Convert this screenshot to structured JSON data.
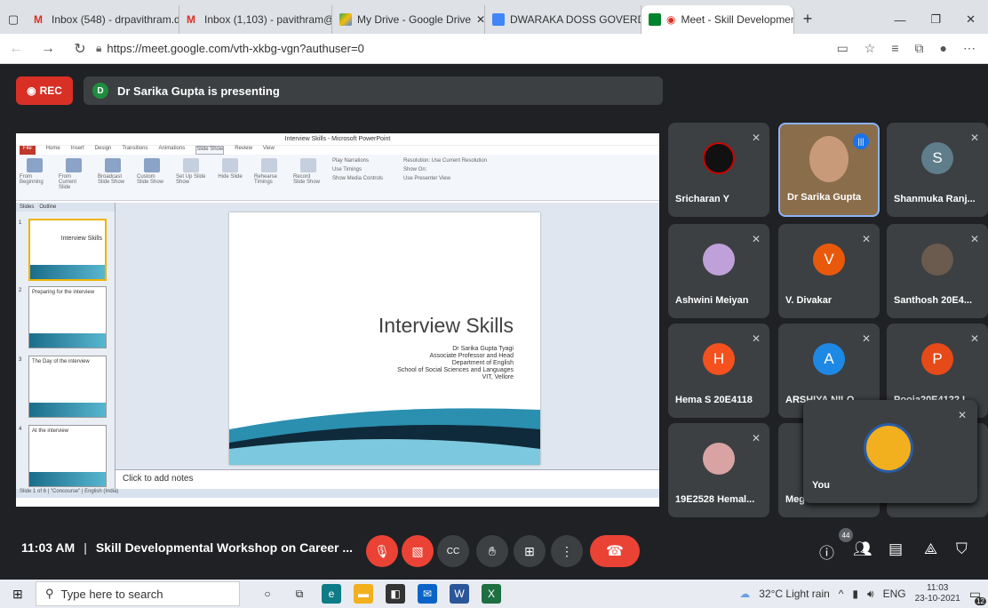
{
  "browser": {
    "tabs": [
      {
        "label": "Inbox (548) - drpavithram.dg",
        "icon": "gmail-icon"
      },
      {
        "label": "Inbox (1,103) - pavithram@dc",
        "icon": "gmail-icon"
      },
      {
        "label": "My Drive - Google Drive",
        "icon": "drive-icon"
      },
      {
        "label": "DWARAKA DOSS GOVERDHA",
        "icon": "calendar-icon"
      },
      {
        "label": "Meet - Skill Developmen",
        "icon": "meet-icon"
      }
    ],
    "url": "https://meet.google.com/vth-xkbg-vgn?authuser=0"
  },
  "meet": {
    "rec_label": "REC",
    "presenter_initial": "D",
    "presenting_text": "Dr Sarika Gupta is presenting",
    "participants": [
      {
        "name": "Sricharan Y",
        "initial": "",
        "color": "#111111"
      },
      {
        "name": "Dr Sarika Gupta",
        "initial": "",
        "color": "#8a6d4a"
      },
      {
        "name": "Shanmuka Ranj...",
        "initial": "S",
        "color": "#607d8b"
      },
      {
        "name": "Ashwini Meiyan",
        "initial": "",
        "color": "#c0a0d8"
      },
      {
        "name": "V. Divakar",
        "initial": "V",
        "color": "#e8590c"
      },
      {
        "name": "Santhosh 20E4...",
        "initial": "",
        "color": "#6b5a4e"
      },
      {
        "name": "Hema S 20E4118",
        "initial": "H",
        "color": "#f4511e"
      },
      {
        "name": "ARSHIYA NILO...",
        "initial": "A",
        "color": "#1e88e5"
      },
      {
        "name": "Pooja20E4122 I...",
        "initial": "P",
        "color": "#e64a19"
      },
      {
        "name": "19E2528 Hemal...",
        "initial": "",
        "color": "#d9a3a3"
      },
      {
        "name": "Meg",
        "initial": "",
        "color": "#3c4043"
      }
    ],
    "self_label": "You",
    "meeting_time": "11:03 AM",
    "meeting_title": "Skill Developmental Workshop on Career ...",
    "participant_count": "44"
  },
  "powerpoint": {
    "window_title": "Interview Skills - Microsoft PowerPoint",
    "menu_tabs": [
      "File",
      "Home",
      "Insert",
      "Design",
      "Transitions",
      "Animations",
      "Slide Show",
      "Review",
      "View"
    ],
    "ribbon": [
      "From Beginning",
      "From Current Slide",
      "Broadcast Slide Show",
      "Custom Slide Show",
      "Set Up Slide Show",
      "Hide Slide",
      "Rehearse Timings",
      "Record Slide Show",
      "Play Narrations",
      "Use Timings",
      "Show Media Controls",
      "Resolution: Use Current Resolution",
      "Show On:",
      "Use Presenter View"
    ],
    "panel_tabs": [
      "Slides",
      "Outline"
    ],
    "thumbnails": [
      {
        "num": "1",
        "title": "Interview Skills"
      },
      {
        "num": "2",
        "title": "Preparing for the interview"
      },
      {
        "num": "3",
        "title": "The Day of the interview"
      },
      {
        "num": "4",
        "title": "At the interview"
      }
    ],
    "slide_title": "Interview Skills",
    "slide_author": "Dr Sarika Gupta Tyagi",
    "slide_role": "Associate Professor and Head",
    "slide_dept": "Department of English",
    "slide_school": "School of Social Sciences and Languages",
    "slide_inst": "VIT, Vellore",
    "notes_placeholder": "Click to add notes",
    "status_text": "Slide 1 of 6 | \"Concourse\" | English (India)"
  },
  "taskbar": {
    "search_placeholder": "Type here to search",
    "weather": "32°C  Light rain",
    "lang": "ENG",
    "time": "11:03",
    "date": "23-10-2021",
    "notif_count": "12"
  }
}
